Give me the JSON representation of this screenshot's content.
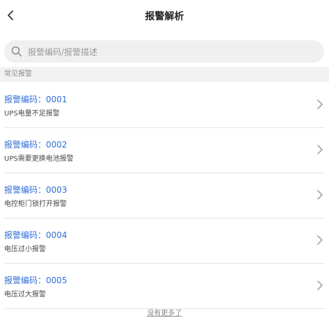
{
  "header": {
    "title": "报警解析",
    "back_icon": "chevron-left-icon"
  },
  "search": {
    "placeholder": "报警编码/报警描述",
    "value": "",
    "icon": "search-icon"
  },
  "section": {
    "label": "常见报警"
  },
  "alarms": [
    {
      "code": "报警编码：0001",
      "desc": "UPS电量不足报警"
    },
    {
      "code": "报警编码：0002",
      "desc": "UPS需要更换电池报警"
    },
    {
      "code": "报警编码：0003",
      "desc": "电控柜门锁打开报警"
    },
    {
      "code": "报警编码：0004",
      "desc": "电压过小报警"
    },
    {
      "code": "报警编码：0005",
      "desc": "电压过大报警"
    }
  ],
  "footer": {
    "no_more": "没有更多了"
  },
  "colors": {
    "accent": "#2f6fd8",
    "background": "#ffffff",
    "section_bg": "#f2f2f2"
  }
}
